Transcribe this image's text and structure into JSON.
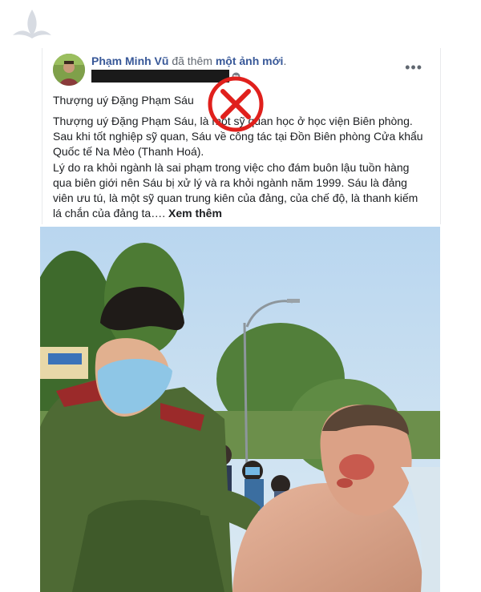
{
  "post": {
    "author": "Phạm Minh Vũ",
    "action_prefix": "đã thêm",
    "action_object": "một ảnh mới",
    "action_suffix": ".",
    "more_glyph": "•••",
    "title": "Thượng uý Đặng Phạm Sáu",
    "paragraph1": "Thượng uý Đặng Phạm Sáu, là một sỹ quan học ở học viện Biên phòng. Sau khi tốt nghiệp sỹ quan, Sáu về công tác tại Đồn Biên phòng Cửa khẩu Quốc tế Na Mèo (Thanh Hoá).",
    "paragraph2": "Lý do ra khỏi ngành là sai phạm trong việc cho đám buôn lậu tuồn hàng qua biên giới nên Sáu bị xử lý và ra khỏi ngành năm 1999. Sáu là đảng viên ưu tú, là một sỹ quan trung kiên của đảng, của chế độ, là thanh kiếm lá chắn của đảng ta….",
    "see_more": "Xem thêm"
  },
  "icons": {
    "globe": "globe-icon",
    "more": "more-options-icon",
    "red_x": "red-x-stamp-icon",
    "watermark": "crane-logo-icon"
  },
  "colors": {
    "link_blue": "#385898",
    "red_stamp": "#e0201c",
    "uniform_green": "#4e6a34"
  }
}
